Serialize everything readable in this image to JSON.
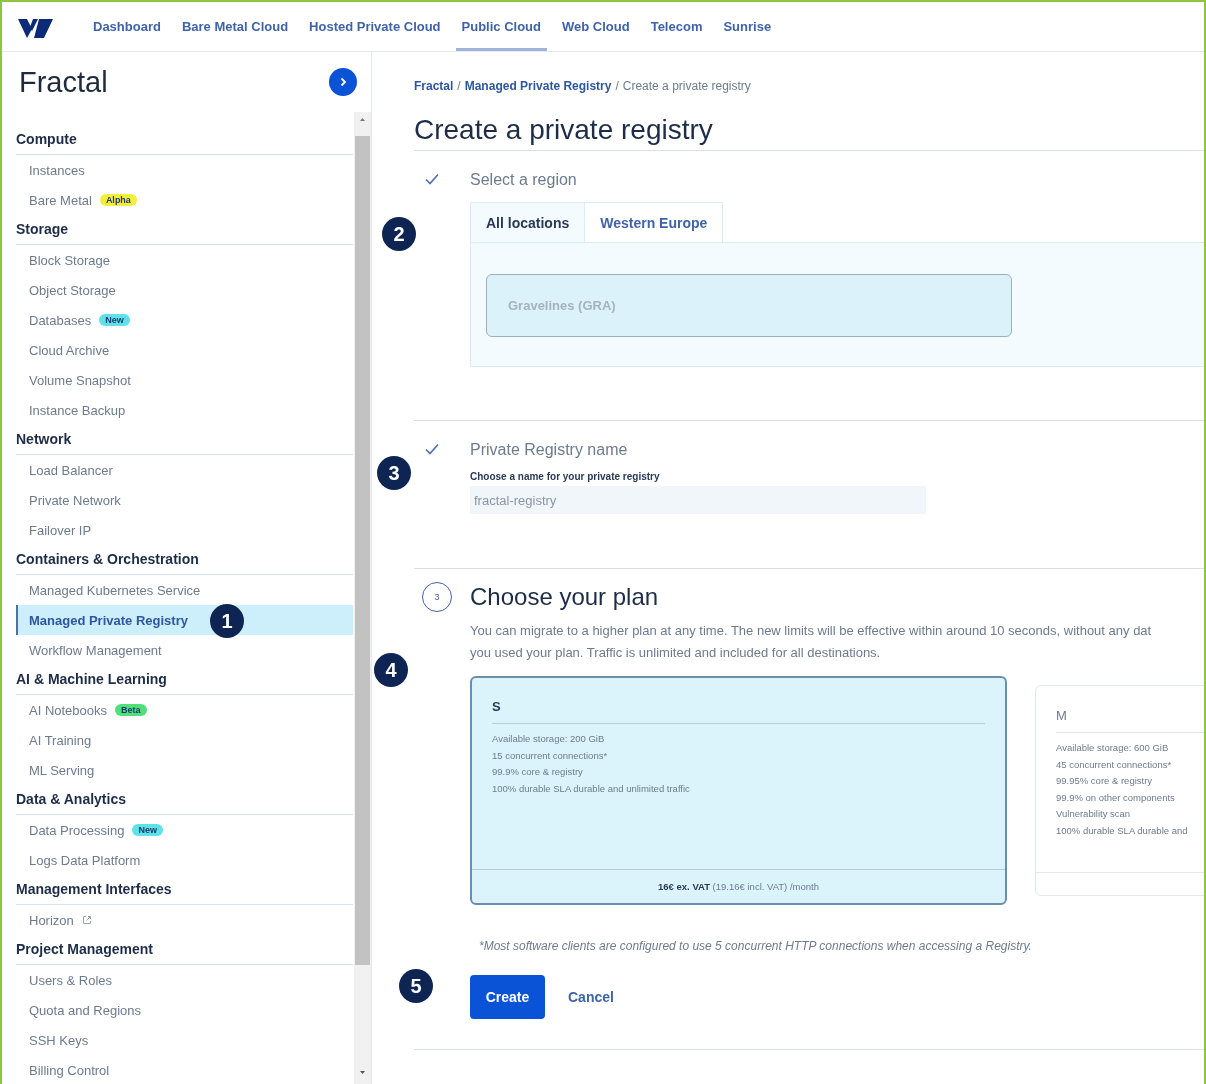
{
  "nav": {
    "tabs": [
      {
        "label": "Dashboard",
        "selected": false
      },
      {
        "label": "Bare Metal Cloud",
        "selected": false
      },
      {
        "label": "Hosted Private Cloud",
        "selected": false
      },
      {
        "label": "Public Cloud",
        "selected": true
      },
      {
        "label": "Web Cloud",
        "selected": false
      },
      {
        "label": "Telecom",
        "selected": false
      },
      {
        "label": "Sunrise",
        "selected": false
      }
    ]
  },
  "sidebar": {
    "project": "Fractal",
    "sections": [
      {
        "heading": "Compute",
        "items": [
          {
            "label": "Instances",
            "kind": "link",
            "selected": false
          },
          {
            "label": "Bare Metal",
            "kind": "link",
            "selected": false,
            "badge": {
              "text": "Alpha",
              "color": "#f3ee3c"
            }
          }
        ]
      },
      {
        "heading": "Storage",
        "items": [
          {
            "label": "Block Storage",
            "kind": "link",
            "selected": false
          },
          {
            "label": "Object Storage",
            "kind": "link",
            "selected": false
          },
          {
            "label": "Databases",
            "kind": "link",
            "selected": false,
            "badge": {
              "text": "New",
              "color": "#5fe1ea"
            }
          },
          {
            "label": "Cloud Archive",
            "kind": "link",
            "selected": false
          },
          {
            "label": "Volume Snapshot",
            "kind": "link",
            "selected": false
          },
          {
            "label": "Instance Backup",
            "kind": "link",
            "selected": false
          }
        ]
      },
      {
        "heading": "Network",
        "items": [
          {
            "label": "Load Balancer",
            "kind": "link",
            "selected": false
          },
          {
            "label": "Private Network",
            "kind": "link",
            "selected": false
          },
          {
            "label": "Failover IP",
            "kind": "link",
            "selected": false
          }
        ]
      },
      {
        "heading": "Containers & Orchestration",
        "items": [
          {
            "label": "Managed Kubernetes Service",
            "kind": "link",
            "selected": false
          },
          {
            "label": "Managed Private Registry",
            "kind": "link",
            "selected": true
          },
          {
            "label": "Workflow Management",
            "kind": "link",
            "selected": false
          }
        ]
      },
      {
        "heading": "AI & Machine Learning",
        "items": [
          {
            "label": "AI Notebooks",
            "kind": "link",
            "selected": false,
            "badge": {
              "text": "Beta",
              "color": "#4fe07c"
            }
          },
          {
            "label": "AI Training",
            "kind": "link",
            "selected": false
          },
          {
            "label": "ML Serving",
            "kind": "link",
            "selected": false
          }
        ]
      },
      {
        "heading": "Data & Analytics",
        "items": [
          {
            "label": "Data Processing",
            "kind": "link",
            "selected": false,
            "badge": {
              "text": "New",
              "color": "#5fe1ea"
            }
          },
          {
            "label": "Logs Data Platform",
            "kind": "link",
            "selected": false
          }
        ]
      },
      {
        "heading": "Management Interfaces",
        "items": [
          {
            "label": "Horizon",
            "kind": "external",
            "selected": false
          }
        ]
      },
      {
        "heading": "Project Management",
        "items": [
          {
            "label": "Users & Roles",
            "kind": "link",
            "selected": false
          },
          {
            "label": "Quota and Regions",
            "kind": "link",
            "selected": false
          },
          {
            "label": "SSH Keys",
            "kind": "link",
            "selected": false
          },
          {
            "label": "Billing Control",
            "kind": "link",
            "selected": false
          }
        ]
      }
    ]
  },
  "breadcrumb": {
    "separator": "/",
    "items": [
      {
        "label": "Fractal",
        "link": true
      },
      {
        "label": "Managed Private Registry",
        "link": true
      },
      {
        "label": "Create a private registry",
        "link": false
      }
    ]
  },
  "title": "Create a private registry",
  "steps": [
    {
      "kind": "region",
      "done": true,
      "title": "Select a region",
      "tabs": [
        {
          "label": "All locations",
          "selected": true
        },
        {
          "label": "Western Europe",
          "selected": false
        }
      ],
      "locations": [
        {
          "label": "Gravelines (GRA)",
          "disabled": true
        }
      ]
    },
    {
      "kind": "name",
      "done": true,
      "title": "Private Registry name",
      "field_label": "Choose a name for your private registry",
      "value": "fractal-registry"
    },
    {
      "kind": "plan",
      "done": false,
      "number": "3",
      "title": "Choose your plan",
      "description_lines": [
        "You can migrate to a higher plan at any time. The new limits will be effective within around 10 seconds, without any dat",
        "you used your plan. Traffic is unlimited and included for all destinations."
      ],
      "plans": [
        {
          "name": "S",
          "selected": true,
          "features": [
            "Available storage: 200 GiB",
            "15 concurrent connections*",
            "99.9% core & registry",
            "100% durable SLA durable and unlimited traffic"
          ],
          "price": "**16€ ex. VAT** (19.16€ incl. VAT) /month"
        },
        {
          "name": "M",
          "selected": false,
          "features": [
            "Available storage: 600 GiB",
            "45 concurrent connections*",
            "99.95% core & registry",
            "99.9% on other components",
            "Vulnerability scan",
            "100% durable SLA durable and"
          ]
        }
      ],
      "footnote": "*Most software clients are configured to use 5 concurrent HTTP connections when accessing a Registry."
    }
  ],
  "actions": {
    "create": "Create",
    "cancel": "Cancel"
  },
  "callouts": [
    "1",
    "2",
    "3",
    "4",
    "5"
  ]
}
